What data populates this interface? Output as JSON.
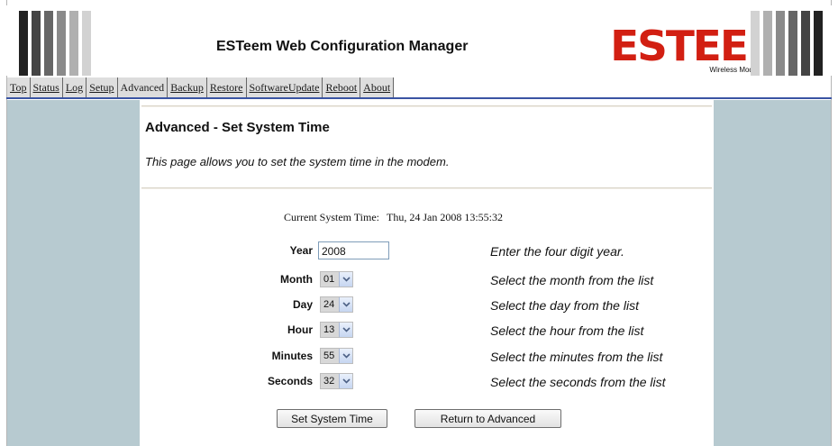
{
  "header": {
    "title": "ESTeem Web Configuration Manager",
    "logo_text": "ESTEEM",
    "logo_tagline": "Wireless Modems",
    "brand_color": "#d21f12"
  },
  "tabs": [
    {
      "label": "Top"
    },
    {
      "label": "Status"
    },
    {
      "label": "Log"
    },
    {
      "label": "Setup"
    },
    {
      "label": "Advanced",
      "active": true
    },
    {
      "label": "Backup"
    },
    {
      "label": "Restore"
    },
    {
      "label": "SoftwareUpdate"
    },
    {
      "label": "Reboot"
    },
    {
      "label": "About"
    }
  ],
  "page": {
    "title": "Advanced - Set System Time",
    "description": "This page allows you to set the system time in the modem.",
    "current_time_label": "Current System Time:",
    "current_time_value": "Thu, 24 Jan 2008 13:55:32"
  },
  "fields": {
    "year": {
      "label": "Year",
      "value": "2008",
      "help": "Enter the four digit year."
    },
    "month": {
      "label": "Month",
      "value": "01",
      "help": "Select the month from the list"
    },
    "day": {
      "label": "Day",
      "value": "24",
      "help": "Select the day from the list"
    },
    "hour": {
      "label": "Hour",
      "value": "13",
      "help": "Select the hour from the list"
    },
    "minutes": {
      "label": "Minutes",
      "value": "55",
      "help": "Select the minutes from the list"
    },
    "seconds": {
      "label": "Seconds",
      "value": "32",
      "help": "Select the seconds from the list"
    }
  },
  "buttons": {
    "set": "Set System Time",
    "return": "Return to Advanced"
  },
  "colors": {
    "side_panel": "#b7cad0",
    "tab_underline": "#3a54a3"
  }
}
